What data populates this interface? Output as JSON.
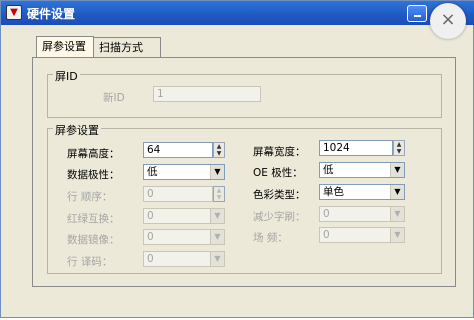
{
  "window": {
    "title": "硬件设置",
    "close_glyph": "×"
  },
  "tabs": [
    {
      "label": "屏参设置"
    },
    {
      "label": "扫描方式"
    }
  ],
  "screen_id_group": {
    "legend": "屏ID",
    "new_id_label": "新ID",
    "new_id_value": "1"
  },
  "params_group": {
    "legend": "屏参设置",
    "height": {
      "label": "屏幕高度：",
      "value": "64"
    },
    "width": {
      "label": "屏幕宽度：",
      "value": "1024"
    },
    "data_polarity": {
      "label": "数据极性：",
      "value": "低"
    },
    "oe_polarity": {
      "label": "OE 极性：",
      "value": "低"
    },
    "row_order": {
      "label": "行 顺序：",
      "value": "0"
    },
    "color_type": {
      "label": "色彩类型：",
      "value": "单色"
    },
    "red_green_swap": {
      "label": "红绿互换：",
      "value": "0"
    },
    "reduce_scan": {
      "label": "减少字刷：",
      "value": "0"
    },
    "data_mirror": {
      "label": "数据镜像：",
      "value": "0"
    },
    "field": {
      "label": "场 频：",
      "value": "0"
    },
    "row_decode": {
      "label": "行 译码：",
      "value": "0"
    }
  },
  "colors": {
    "titlebar": "#2f74d8",
    "window_bg": "#ece9d8",
    "field_border": "#7f9db9"
  },
  "icons": [
    "app-icon",
    "minimize-icon",
    "close-icon",
    "spin-up-icon",
    "spin-down-icon",
    "dropdown-arrow-icon"
  ]
}
